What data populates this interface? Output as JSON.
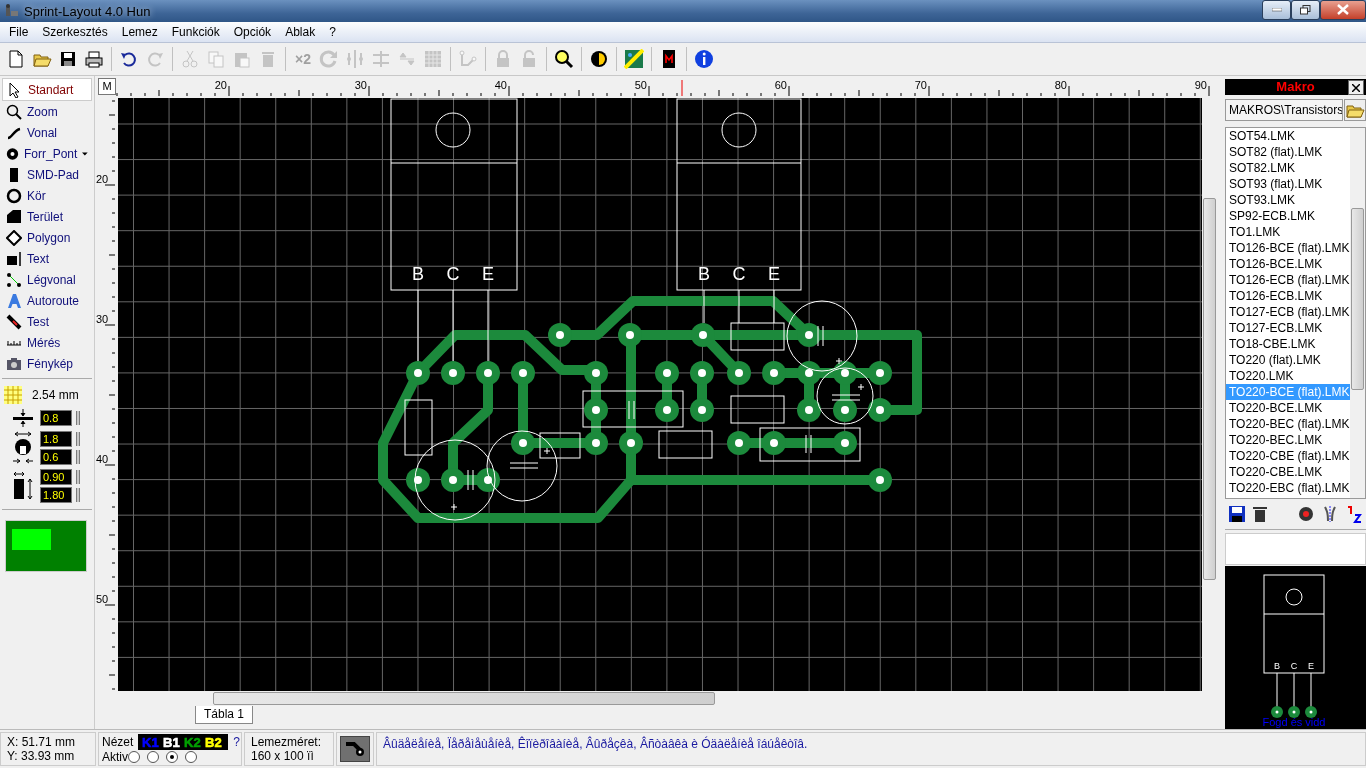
{
  "window": {
    "title": "Sprint-Layout 4.0 Hun"
  },
  "menu": [
    "File",
    "Szerkesztés",
    "Lemez",
    "Funkciók",
    "Opciók",
    "Ablak",
    "?"
  ],
  "toolbar": [
    {
      "kind": "new",
      "disabled": false
    },
    {
      "kind": "open",
      "disabled": false
    },
    {
      "kind": "save",
      "disabled": false
    },
    {
      "kind": "print",
      "disabled": false
    },
    {
      "kind": "sep"
    },
    {
      "kind": "undo",
      "disabled": false
    },
    {
      "kind": "redo",
      "disabled": true
    },
    {
      "kind": "sep"
    },
    {
      "kind": "cut",
      "disabled": true
    },
    {
      "kind": "copy",
      "disabled": true
    },
    {
      "kind": "paste",
      "disabled": true
    },
    {
      "kind": "delete",
      "disabled": true
    },
    {
      "kind": "sep"
    },
    {
      "kind": "text",
      "label": "×2",
      "disabled": true
    },
    {
      "kind": "rotate",
      "disabled": true
    },
    {
      "kind": "mirror",
      "disabled": true
    },
    {
      "kind": "align",
      "disabled": true
    },
    {
      "kind": "flip",
      "disabled": true
    },
    {
      "kind": "pattern",
      "disabled": true
    },
    {
      "kind": "sep"
    },
    {
      "kind": "connect",
      "disabled": true
    },
    {
      "kind": "sep"
    },
    {
      "kind": "lock",
      "disabled": true
    },
    {
      "kind": "unlock",
      "disabled": true
    },
    {
      "kind": "sep"
    },
    {
      "kind": "zoom",
      "disabled": false
    },
    {
      "kind": "sep"
    },
    {
      "kind": "layer",
      "disabled": false
    },
    {
      "kind": "sep"
    },
    {
      "kind": "drc",
      "disabled": false
    },
    {
      "kind": "sep"
    },
    {
      "kind": "macro",
      "disabled": false
    },
    {
      "kind": "sep"
    },
    {
      "kind": "info",
      "disabled": false
    }
  ],
  "tools": [
    {
      "kind": "arrow",
      "label": "Standart",
      "selected": true
    },
    {
      "kind": "zoom",
      "label": "Zoom",
      "selected": false
    },
    {
      "kind": "line",
      "label": "Vonal",
      "selected": false
    },
    {
      "kind": "pad",
      "label": "Forr_Pont",
      "selected": false,
      "dropdown": true
    },
    {
      "kind": "smd",
      "label": "SMD-Pad",
      "selected": false
    },
    {
      "kind": "circle",
      "label": "Kör",
      "selected": false
    },
    {
      "kind": "area",
      "label": "Terület",
      "selected": false
    },
    {
      "kind": "polygon",
      "label": "Polygon",
      "selected": false
    },
    {
      "kind": "text",
      "label": "Text",
      "selected": false
    },
    {
      "kind": "airwire",
      "label": "Légvonal",
      "selected": false
    },
    {
      "kind": "autoroute",
      "label": "Autoroute",
      "selected": false
    },
    {
      "kind": "test",
      "label": "Test",
      "selected": false
    },
    {
      "kind": "measure",
      "label": "Mérés",
      "selected": false
    },
    {
      "kind": "camera",
      "label": "Fénykép",
      "selected": false
    }
  ],
  "grid": {
    "value": "2.54 mm"
  },
  "settings": [
    {
      "kind": "track",
      "values": [
        "0.8"
      ]
    },
    {
      "kind": "pad",
      "values": [
        "1.8",
        "0.6"
      ]
    },
    {
      "kind": "smd",
      "values": [
        "0.90",
        "1.80"
      ]
    }
  ],
  "ruler_top": {
    "corner": "M",
    "labels": [
      "20",
      "30",
      "40",
      "50",
      "60",
      "70",
      "80",
      "90"
    ]
  },
  "ruler_left": {
    "labels": [
      "20",
      "30",
      "40",
      "50"
    ]
  },
  "board": {
    "pin_labels": [
      {
        "text": "B"
      },
      {
        "text": "C"
      },
      {
        "text": "E"
      },
      {
        "text": "B"
      },
      {
        "text": "C"
      },
      {
        "text": "E"
      }
    ]
  },
  "sheet_tabs": [
    {
      "label": "Tábla 1",
      "selected": true
    }
  ],
  "macro_panel": {
    "title": "Makro",
    "folder": "MAKROS\\Transistors",
    "items": [
      {
        "label": "SOT54.LMK",
        "selected": false
      },
      {
        "label": "SOT82 (flat).LMK",
        "selected": false
      },
      {
        "label": "SOT82.LMK",
        "selected": false
      },
      {
        "label": "SOT93 (flat).LMK",
        "selected": false
      },
      {
        "label": "SOT93.LMK",
        "selected": false
      },
      {
        "label": "SP92-ECB.LMK",
        "selected": false
      },
      {
        "label": "TO1.LMK",
        "selected": false
      },
      {
        "label": "TO126-BCE (flat).LMK",
        "selected": false
      },
      {
        "label": "TO126-BCE.LMK",
        "selected": false
      },
      {
        "label": "TO126-ECB (flat).LMK",
        "selected": false
      },
      {
        "label": "TO126-ECB.LMK",
        "selected": false
      },
      {
        "label": "TO127-ECB (flat).LMK",
        "selected": false
      },
      {
        "label": "TO127-ECB.LMK",
        "selected": false
      },
      {
        "label": "TO18-CBE.LMK",
        "selected": false
      },
      {
        "label": "TO220 (flat).LMK",
        "selected": false
      },
      {
        "label": "TO220.LMK",
        "selected": false
      },
      {
        "label": "TO220-BCE (flat).LMK",
        "selected": true
      },
      {
        "label": "TO220-BCE.LMK",
        "selected": false
      },
      {
        "label": "TO220-BEC (flat).LMK",
        "selected": false
      },
      {
        "label": "TO220-BEC.LMK",
        "selected": false
      },
      {
        "label": "TO220-CBE (flat).LMK",
        "selected": false
      },
      {
        "label": "TO220-CBE.LMK",
        "selected": false
      },
      {
        "label": "TO220-EBC (flat).LMK",
        "selected": false
      }
    ],
    "preview": {
      "pin_labels": [
        "B",
        "C",
        "E"
      ],
      "caption": "Fogd és vidd"
    }
  },
  "status_bar": {
    "x": "X: 51.71 mm",
    "y": "Y: 33.93 mm",
    "view_label": "Nézet",
    "layers": [
      {
        "label": "K1"
      },
      {
        "label": "B1"
      },
      {
        "label": "K2"
      },
      {
        "label": "B2"
      }
    ],
    "help": "?",
    "active_label": "Aktiv",
    "active_layer": [
      {
        "selected": false
      },
      {
        "selected": false
      },
      {
        "selected": true
      },
      {
        "selected": false
      }
    ],
    "board_size_label": "Lemezméret:",
    "board_size": "160 x 100 ïì",
    "message": "Âûäåëåíèå, Ïåðåìåùåíèå, Êîïèðîâàíèå, Âûðåçêà, Âñòàâêà è Óäàëåíèå îáúåêòîâ."
  }
}
